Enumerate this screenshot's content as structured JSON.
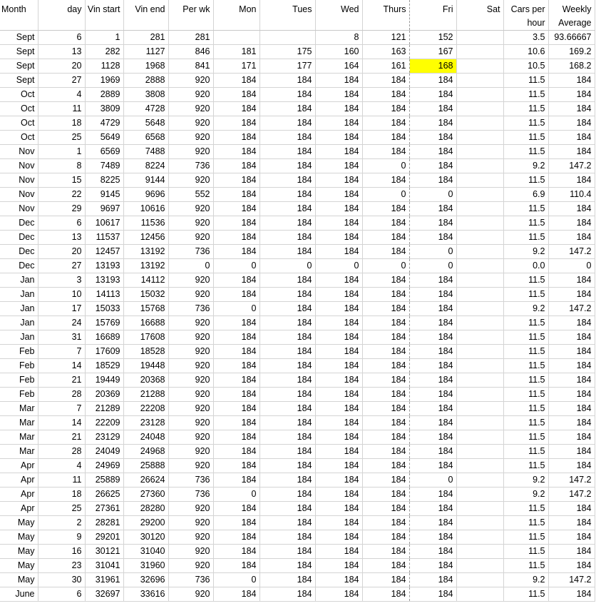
{
  "sheet": {
    "headers": [
      "Month",
      "day",
      "Vin start",
      "Vin end",
      "Per wk",
      "Mon",
      "Tues",
      "Wed",
      "Thurs",
      "Fri",
      "Sat",
      "Cars per hour",
      "Weekly Average"
    ],
    "highlight_color": "#ffff00",
    "highlighted_cell": {
      "row": 2,
      "col": 9
    },
    "rows": [
      [
        "Sept",
        "6",
        "1",
        "281",
        "281",
        "",
        "",
        "8",
        "121",
        "152",
        "",
        "3.5",
        "93.66667"
      ],
      [
        "Sept",
        "13",
        "282",
        "1127",
        "846",
        "181",
        "175",
        "160",
        "163",
        "167",
        "",
        "10.6",
        "169.2"
      ],
      [
        "Sept",
        "20",
        "1128",
        "1968",
        "841",
        "171",
        "177",
        "164",
        "161",
        "168",
        "",
        "10.5",
        "168.2"
      ],
      [
        "Sept",
        "27",
        "1969",
        "2888",
        "920",
        "184",
        "184",
        "184",
        "184",
        "184",
        "",
        "11.5",
        "184"
      ],
      [
        "Oct",
        "4",
        "2889",
        "3808",
        "920",
        "184",
        "184",
        "184",
        "184",
        "184",
        "",
        "11.5",
        "184"
      ],
      [
        "Oct",
        "11",
        "3809",
        "4728",
        "920",
        "184",
        "184",
        "184",
        "184",
        "184",
        "",
        "11.5",
        "184"
      ],
      [
        "Oct",
        "18",
        "4729",
        "5648",
        "920",
        "184",
        "184",
        "184",
        "184",
        "184",
        "",
        "11.5",
        "184"
      ],
      [
        "Oct",
        "25",
        "5649",
        "6568",
        "920",
        "184",
        "184",
        "184",
        "184",
        "184",
        "",
        "11.5",
        "184"
      ],
      [
        "Nov",
        "1",
        "6569",
        "7488",
        "920",
        "184",
        "184",
        "184",
        "184",
        "184",
        "",
        "11.5",
        "184"
      ],
      [
        "Nov",
        "8",
        "7489",
        "8224",
        "736",
        "184",
        "184",
        "184",
        "0",
        "184",
        "",
        "9.2",
        "147.2"
      ],
      [
        "Nov",
        "15",
        "8225",
        "9144",
        "920",
        "184",
        "184",
        "184",
        "184",
        "184",
        "",
        "11.5",
        "184"
      ],
      [
        "Nov",
        "22",
        "9145",
        "9696",
        "552",
        "184",
        "184",
        "184",
        "0",
        "0",
        "",
        "6.9",
        "110.4"
      ],
      [
        "Nov",
        "29",
        "9697",
        "10616",
        "920",
        "184",
        "184",
        "184",
        "184",
        "184",
        "",
        "11.5",
        "184"
      ],
      [
        "Dec",
        "6",
        "10617",
        "11536",
        "920",
        "184",
        "184",
        "184",
        "184",
        "184",
        "",
        "11.5",
        "184"
      ],
      [
        "Dec",
        "13",
        "11537",
        "12456",
        "920",
        "184",
        "184",
        "184",
        "184",
        "184",
        "",
        "11.5",
        "184"
      ],
      [
        "Dec",
        "20",
        "12457",
        "13192",
        "736",
        "184",
        "184",
        "184",
        "184",
        "0",
        "",
        "9.2",
        "147.2"
      ],
      [
        "Dec",
        "27",
        "13193",
        "13192",
        "0",
        "0",
        "0",
        "0",
        "0",
        "0",
        "",
        "0.0",
        "0"
      ],
      [
        "Jan",
        "3",
        "13193",
        "14112",
        "920",
        "184",
        "184",
        "184",
        "184",
        "184",
        "",
        "11.5",
        "184"
      ],
      [
        "Jan",
        "10",
        "14113",
        "15032",
        "920",
        "184",
        "184",
        "184",
        "184",
        "184",
        "",
        "11.5",
        "184"
      ],
      [
        "Jan",
        "17",
        "15033",
        "15768",
        "736",
        "0",
        "184",
        "184",
        "184",
        "184",
        "",
        "9.2",
        "147.2"
      ],
      [
        "Jan",
        "24",
        "15769",
        "16688",
        "920",
        "184",
        "184",
        "184",
        "184",
        "184",
        "",
        "11.5",
        "184"
      ],
      [
        "Jan",
        "31",
        "16689",
        "17608",
        "920",
        "184",
        "184",
        "184",
        "184",
        "184",
        "",
        "11.5",
        "184"
      ],
      [
        "Feb",
        "7",
        "17609",
        "18528",
        "920",
        "184",
        "184",
        "184",
        "184",
        "184",
        "",
        "11.5",
        "184"
      ],
      [
        "Feb",
        "14",
        "18529",
        "19448",
        "920",
        "184",
        "184",
        "184",
        "184",
        "184",
        "",
        "11.5",
        "184"
      ],
      [
        "Feb",
        "21",
        "19449",
        "20368",
        "920",
        "184",
        "184",
        "184",
        "184",
        "184",
        "",
        "11.5",
        "184"
      ],
      [
        "Feb",
        "28",
        "20369",
        "21288",
        "920",
        "184",
        "184",
        "184",
        "184",
        "184",
        "",
        "11.5",
        "184"
      ],
      [
        "Mar",
        "7",
        "21289",
        "22208",
        "920",
        "184",
        "184",
        "184",
        "184",
        "184",
        "",
        "11.5",
        "184"
      ],
      [
        "Mar",
        "14",
        "22209",
        "23128",
        "920",
        "184",
        "184",
        "184",
        "184",
        "184",
        "",
        "11.5",
        "184"
      ],
      [
        "Mar",
        "21",
        "23129",
        "24048",
        "920",
        "184",
        "184",
        "184",
        "184",
        "184",
        "",
        "11.5",
        "184"
      ],
      [
        "Mar",
        "28",
        "24049",
        "24968",
        "920",
        "184",
        "184",
        "184",
        "184",
        "184",
        "",
        "11.5",
        "184"
      ],
      [
        "Apr",
        "4",
        "24969",
        "25888",
        "920",
        "184",
        "184",
        "184",
        "184",
        "184",
        "",
        "11.5",
        "184"
      ],
      [
        "Apr",
        "11",
        "25889",
        "26624",
        "736",
        "184",
        "184",
        "184",
        "184",
        "0",
        "",
        "9.2",
        "147.2"
      ],
      [
        "Apr",
        "18",
        "26625",
        "27360",
        "736",
        "0",
        "184",
        "184",
        "184",
        "184",
        "",
        "9.2",
        "147.2"
      ],
      [
        "Apr",
        "25",
        "27361",
        "28280",
        "920",
        "184",
        "184",
        "184",
        "184",
        "184",
        "",
        "11.5",
        "184"
      ],
      [
        "May",
        "2",
        "28281",
        "29200",
        "920",
        "184",
        "184",
        "184",
        "184",
        "184",
        "",
        "11.5",
        "184"
      ],
      [
        "May",
        "9",
        "29201",
        "30120",
        "920",
        "184",
        "184",
        "184",
        "184",
        "184",
        "",
        "11.5",
        "184"
      ],
      [
        "May",
        "16",
        "30121",
        "31040",
        "920",
        "184",
        "184",
        "184",
        "184",
        "184",
        "",
        "11.5",
        "184"
      ],
      [
        "May",
        "23",
        "31041",
        "31960",
        "920",
        "184",
        "184",
        "184",
        "184",
        "184",
        "",
        "11.5",
        "184"
      ],
      [
        "May",
        "30",
        "31961",
        "32696",
        "736",
        "0",
        "184",
        "184",
        "184",
        "184",
        "",
        "9.2",
        "147.2"
      ],
      [
        "June",
        "6",
        "32697",
        "33616",
        "920",
        "184",
        "184",
        "184",
        "184",
        "184",
        "",
        "11.5",
        "184"
      ]
    ]
  }
}
